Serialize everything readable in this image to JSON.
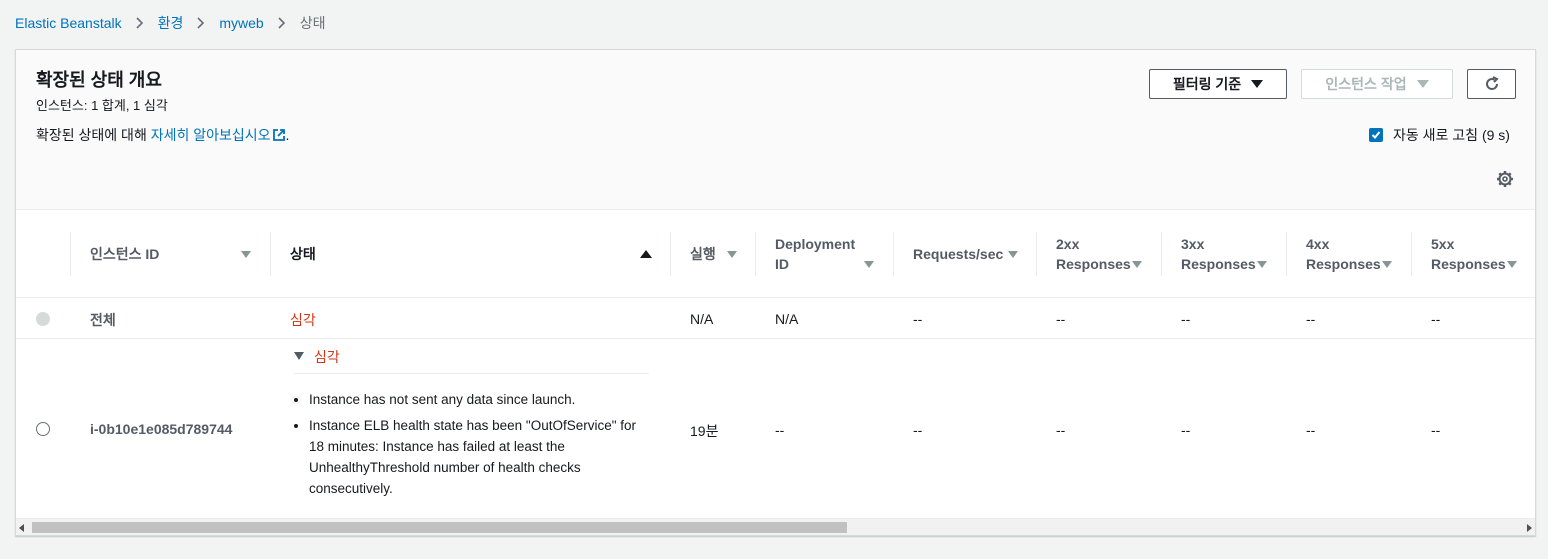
{
  "breadcrumb": [
    "Elastic Beanstalk",
    "환경",
    "myweb",
    "상태"
  ],
  "panel": {
    "title": "확장된 상태 개요",
    "subtitle": "인스턴스: 1 합계, 1 심각",
    "learn_prefix": "확장된 상태에 대해 ",
    "learn_link": "자세히 알아보십시오",
    "learn_suffix": ".",
    "filter_button": "필터링 기준",
    "action_button": "인스턴스 작업",
    "auto_refresh": "자동 새로 고침 (9 s)",
    "auto_refresh_checked": true
  },
  "columns": [
    {
      "l1": "인스턴스 ID",
      "l2": ""
    },
    {
      "l1": "상태",
      "l2": ""
    },
    {
      "l1": "실행",
      "l2": ""
    },
    {
      "l1": "Deployment",
      "l2": "ID"
    },
    {
      "l1": "Requests/sec",
      "l2": ""
    },
    {
      "l1": "2xx",
      "l2": "Responses"
    },
    {
      "l1": "3xx",
      "l2": "Responses"
    },
    {
      "l1": "4xx",
      "l2": "Responses"
    },
    {
      "l1": "5xx",
      "l2": "Responses"
    }
  ],
  "rows": [
    {
      "id": "전체",
      "status": "심각",
      "running": "N/A",
      "deployment": "N/A",
      "rps": "--",
      "r2xx": "--",
      "r3xx": "--",
      "r4xx": "--",
      "r5xx": "--"
    },
    {
      "id": "i-0b10e1e085d789744",
      "status": "심각",
      "causes": [
        "Instance has not sent any data since launch.",
        "Instance ELB health state has been \"OutOfService\" for 18 minutes: Instance has failed at least the UnhealthyThreshold number of health checks consecutively."
      ],
      "running": "19분",
      "deployment": "--",
      "rps": "--",
      "r2xx": "--",
      "r3xx": "--",
      "r4xx": "--",
      "r5xx": "--"
    }
  ],
  "colors": {
    "link": "#0073bb",
    "severe": "#d13212",
    "accent": "#0073bb"
  }
}
